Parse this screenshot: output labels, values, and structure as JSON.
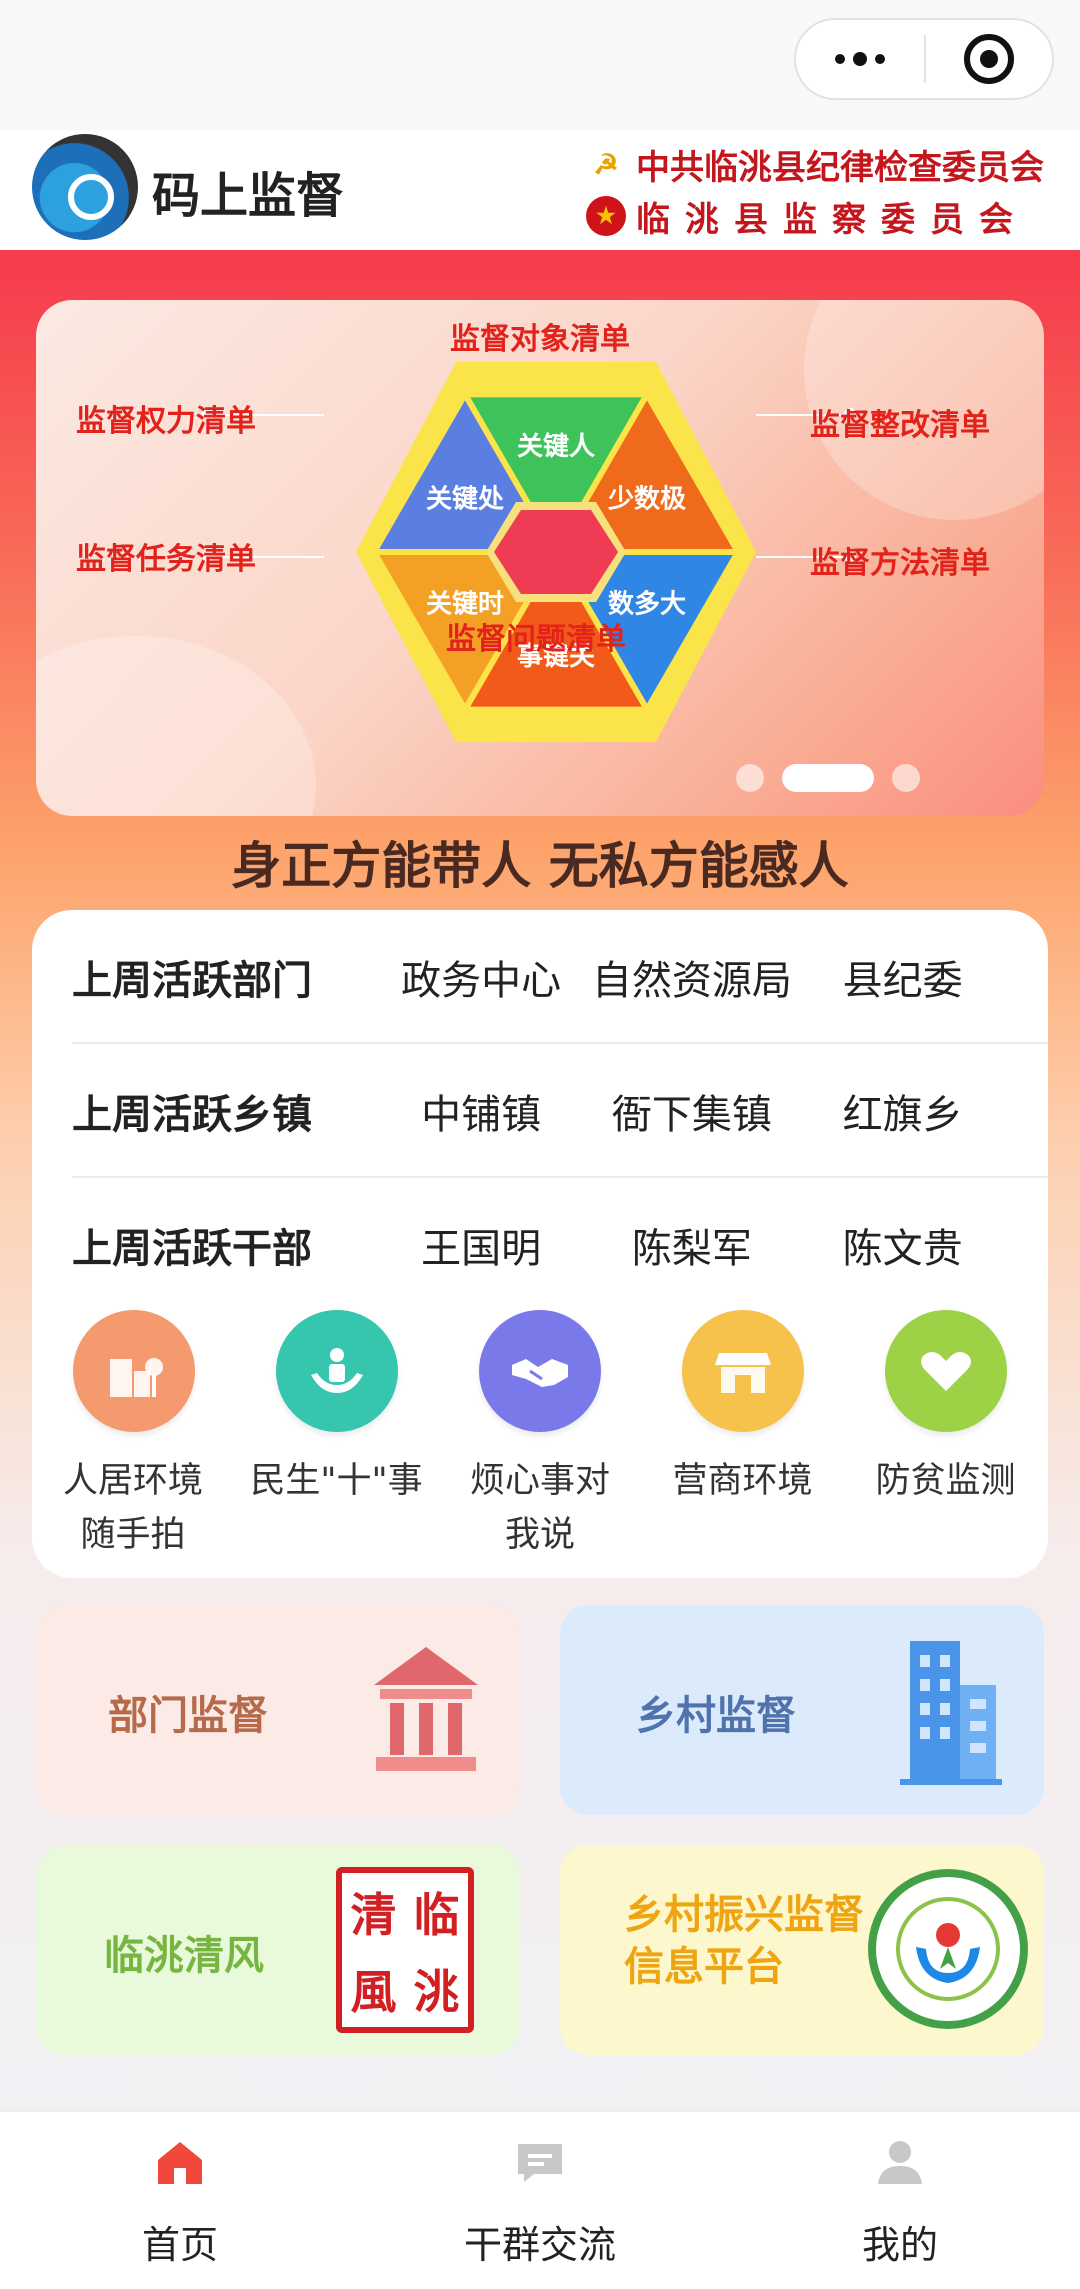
{
  "header": {
    "app_title": "码上监督",
    "org_line1": "中共临洮县纪律检查委员会",
    "org_line2": "临洮县监察委员会"
  },
  "banner": {
    "labels": {
      "top": "监督对象清单",
      "top_left": "监督权力清单",
      "top_right": "监督整改清单",
      "bottom_left": "监督任务清单",
      "bottom_right": "监督方法清单",
      "bottom": "监督问题清单"
    },
    "hex_segments": [
      "关键人",
      "少数极",
      "数多大",
      "事键关",
      "关键时",
      "关键处"
    ],
    "segment_colors": [
      "#3ec35b",
      "#ef6a1a",
      "#2f86e4",
      "#f25a1a",
      "#f4a024",
      "#5a7fe0"
    ],
    "current_page": 2,
    "page_count": 3
  },
  "slogan": "身正方能带人 无私方能感人",
  "active": {
    "rows": [
      {
        "title": "上周活跃部门",
        "values": [
          "政务中心",
          "自然资源局",
          "县纪委"
        ]
      },
      {
        "title": "上周活跃乡镇",
        "values": [
          "中铺镇",
          "衙下集镇",
          "红旗乡"
        ]
      },
      {
        "title": "上周活跃干部",
        "values": [
          "王国明",
          "陈梨军",
          "陈文贵"
        ]
      }
    ]
  },
  "services": [
    {
      "label": "人居环境随手拍",
      "icon": "building-tree-icon",
      "color": "#f49a6e"
    },
    {
      "label": "民生\"十\"事",
      "icon": "people-hands-icon",
      "color": "#36c6ad"
    },
    {
      "label": "烦心事对我说",
      "icon": "handshake-icon",
      "color": "#7a79ea"
    },
    {
      "label": "营商环境",
      "icon": "shop-icon",
      "color": "#f6c24c"
    },
    {
      "label": "防贫监测",
      "icon": "heart-hands-icon",
      "color": "#9dd246"
    }
  ],
  "tiles": {
    "department": "部门监督",
    "village": "乡村监督",
    "qingfeng": "临洮清风",
    "revitalization": "乡村振兴监督信息平台",
    "seal_chars": [
      "清",
      "临",
      "風",
      "洮"
    ]
  },
  "tabbar": {
    "items": [
      "首页",
      "干群交流",
      "我的"
    ],
    "active_color": "#f0483a"
  }
}
